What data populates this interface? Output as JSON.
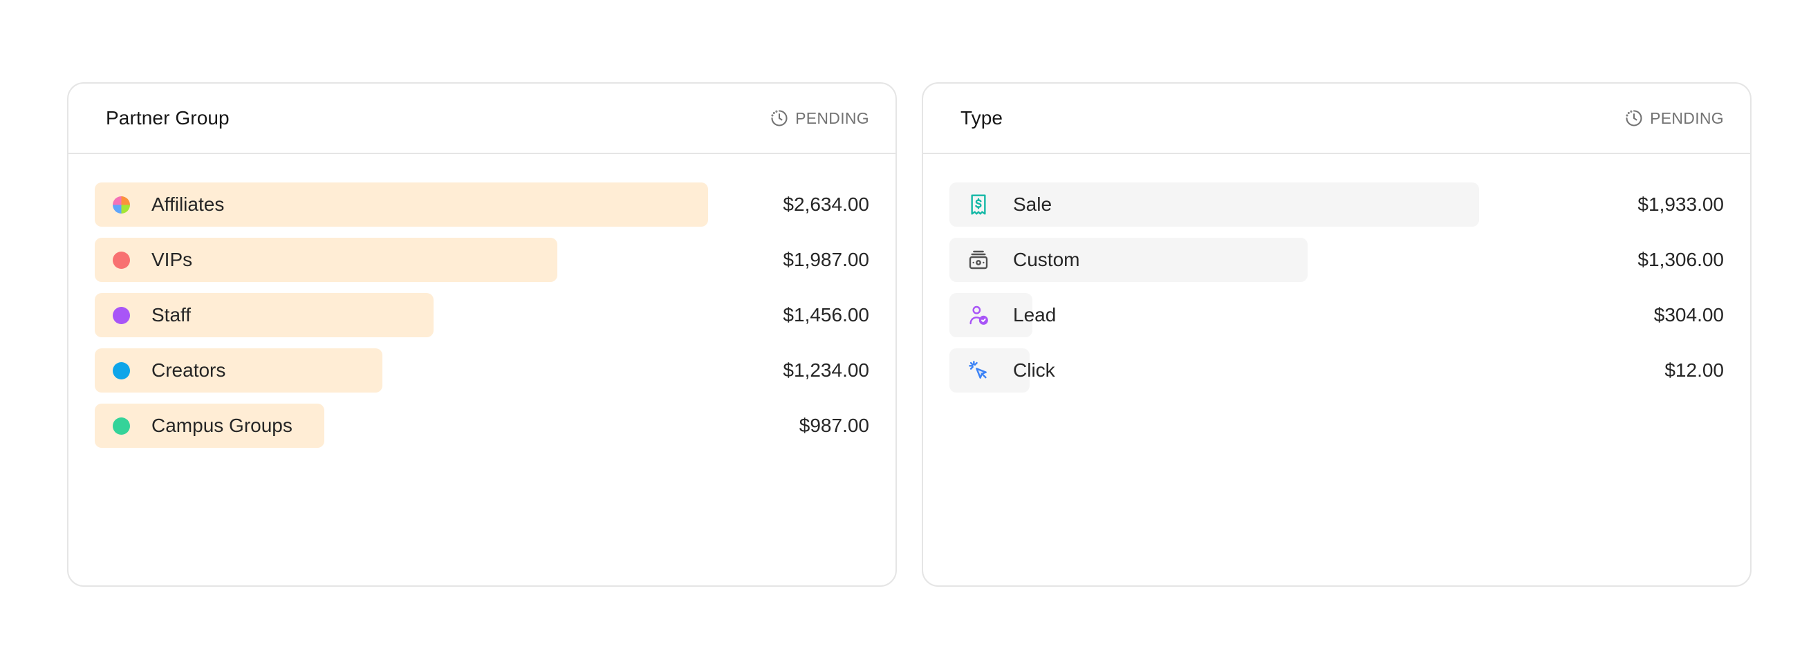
{
  "partner_group": {
    "title": "Partner Group",
    "status": "PENDING",
    "colors": {
      "bar": "#ffedd5"
    },
    "rows": [
      {
        "label": "Affiliates",
        "value": "$2,634.00",
        "amount": 2634,
        "dot": "multicolor"
      },
      {
        "label": "VIPs",
        "value": "$1,987.00",
        "amount": 1987,
        "dot": "#f87171"
      },
      {
        "label": "Staff",
        "value": "$1,456.00",
        "amount": 1456,
        "dot": "#a855f7"
      },
      {
        "label": "Creators",
        "value": "$1,234.00",
        "amount": 1234,
        "dot": "#0ea5e9"
      },
      {
        "label": "Campus Groups",
        "value": "$987.00",
        "amount": 987,
        "dot": "#34d399"
      }
    ]
  },
  "type": {
    "title": "Type",
    "status": "PENDING",
    "colors": {
      "bar": "#f5f5f5"
    },
    "rows": [
      {
        "label": "Sale",
        "value": "$1,933.00",
        "amount": 1933,
        "icon": "receipt-dollar-icon",
        "icon_color": "#14b8a6"
      },
      {
        "label": "Custom",
        "value": "$1,306.00",
        "amount": 1306,
        "icon": "money-stack-icon",
        "icon_color": "#525252"
      },
      {
        "label": "Lead",
        "value": "$304.00",
        "amount": 304,
        "icon": "user-check-icon",
        "icon_color": "#a855f7"
      },
      {
        "label": "Click",
        "value": "$12.00",
        "amount": 12,
        "icon": "cursor-click-icon",
        "icon_color": "#3b82f6"
      }
    ]
  }
}
